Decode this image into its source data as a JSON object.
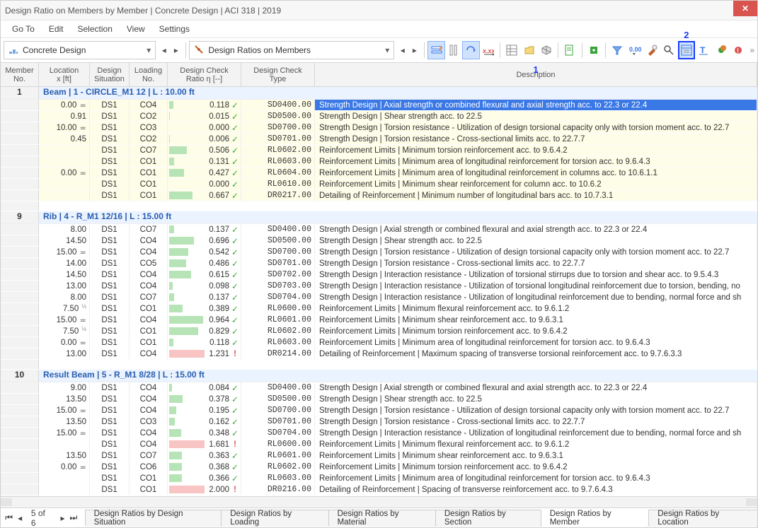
{
  "title": "Design Ratio on Members by Member | Concrete Design | ACI 318 | 2019",
  "menu": {
    "goto": "Go To",
    "edit": "Edit",
    "selection": "Selection",
    "view": "View",
    "settings": "Settings"
  },
  "toolbar": {
    "addon": "Concrete Design",
    "category": "Design Ratios on Members",
    "anno1": "1",
    "anno2": "2"
  },
  "headers": {
    "member": "Member\nNo.",
    "location": "Location\nx [ft]",
    "situation": "Design\nSituation",
    "loading": "Loading\nNo.",
    "ratio": "Design Check\nRatio η [--]",
    "type": "Design Check\nType",
    "desc": "Description"
  },
  "groups": [
    {
      "member": "1",
      "title": "Beam | 1 - CIRCLE_M1 12 | L : 10.00 ft",
      "shaded": true,
      "rows": [
        {
          "loc": "0.00",
          "mark": true,
          "sit": "DS1",
          "load": "CO4",
          "ratio": 0.118,
          "type": "SD0400.00",
          "desc": "Strength Design | Axial strength or combined flexural and axial strength acc. to 22.3 or 22.4",
          "selected": true
        },
        {
          "loc": "0.91",
          "sit": "DS1",
          "load": "CO2",
          "ratio": 0.015,
          "type": "SD0500.00",
          "desc": "Strength Design | Shear strength acc. to 22.5"
        },
        {
          "loc": "10.00",
          "mark": true,
          "sit": "DS1",
          "load": "CO3",
          "ratio": 0.0,
          "type": "SD0700.00",
          "desc": "Strength Design | Torsion resistance - Utilization of design torsional capacity only with torsion moment acc. to 22.7"
        },
        {
          "loc": "0.45",
          "sit": "DS1",
          "load": "CO2",
          "ratio": 0.006,
          "type": "SD0701.00",
          "desc": "Strength Design | Torsion resistance - Cross-sectional limits acc. to 22.7.7"
        },
        {
          "loc": "",
          "sit": "DS1",
          "load": "CO7",
          "ratio": 0.506,
          "type": "RL0602.00",
          "desc": "Reinforcement Limits | Minimum torsion reinforcement acc. to 9.6.4.2"
        },
        {
          "loc": "",
          "sit": "DS1",
          "load": "CO1",
          "ratio": 0.131,
          "type": "RL0603.00",
          "desc": "Reinforcement Limits | Minimum area of longitudinal reinforcement for torsion acc. to 9.6.4.3"
        },
        {
          "loc": "0.00",
          "mark": true,
          "sit": "DS1",
          "load": "CO1",
          "ratio": 0.427,
          "type": "RL0604.00",
          "desc": "Reinforcement Limits | Minimum area of longitudinal reinforcement in columns acc. to 10.6.1.1"
        },
        {
          "loc": "",
          "sit": "DS1",
          "load": "CO1",
          "ratio": 0.0,
          "type": "RL0610.00",
          "desc": "Reinforcement Limits | Minimum shear reinforcement for column acc. to 10.6.2"
        },
        {
          "loc": "",
          "sit": "DS1",
          "load": "CO1",
          "ratio": 0.667,
          "type": "DR0217.00",
          "desc": "Detailing of Reinforcement | Minimum number of longitudinal bars acc. to 10.7.3.1"
        }
      ]
    },
    {
      "member": "9",
      "title": "Rib | 4 - R_M1 12/16 | L : 15.00 ft",
      "shaded": false,
      "rows": [
        {
          "loc": "8.00",
          "sit": "DS1",
          "load": "CO7",
          "ratio": 0.137,
          "type": "SD0400.00",
          "desc": "Strength Design | Axial strength or combined flexural and axial strength acc. to 22.3 or 22.4"
        },
        {
          "loc": "14.50",
          "sit": "DS1",
          "load": "CO4",
          "ratio": 0.696,
          "type": "SD0500.00",
          "desc": "Strength Design | Shear strength acc. to 22.5"
        },
        {
          "loc": "15.00",
          "mark": true,
          "sit": "DS1",
          "load": "CO4",
          "ratio": 0.542,
          "type": "SD0700.00",
          "desc": "Strength Design | Torsion resistance - Utilization of design torsional capacity only with torsion moment acc. to 22.7"
        },
        {
          "loc": "14.00",
          "sit": "DS1",
          "load": "CO5",
          "ratio": 0.486,
          "type": "SD0701.00",
          "desc": "Strength Design | Torsion resistance - Cross-sectional limits acc. to 22.7.7"
        },
        {
          "loc": "14.50",
          "sit": "DS1",
          "load": "CO4",
          "ratio": 0.615,
          "type": "SD0702.00",
          "desc": "Strength Design | Interaction resistance - Utilization of torsional stirrups due to torsion and shear acc. to 9.5.4.3"
        },
        {
          "loc": "13.00",
          "sit": "DS1",
          "load": "CO4",
          "ratio": 0.098,
          "type": "SD0703.00",
          "desc": "Strength Design | Interaction resistance - Utilization of torsional longitudinal reinforcement due to torsion, bending, no"
        },
        {
          "loc": "8.00",
          "sit": "DS1",
          "load": "CO7",
          "ratio": 0.137,
          "type": "SD0704.00",
          "desc": "Strength Design | Interaction resistance - Utilization of longitudinal reinforcement due to bending, normal force and sh"
        },
        {
          "loc": "7.50",
          "half": true,
          "sit": "DS1",
          "load": "CO1",
          "ratio": 0.389,
          "type": "RL0600.00",
          "desc": "Reinforcement Limits | Minimum flexural reinforcement acc. to 9.6.1.2"
        },
        {
          "loc": "15.00",
          "mark": true,
          "sit": "DS1",
          "load": "CO4",
          "ratio": 0.964,
          "type": "RL0601.00",
          "desc": "Reinforcement Limits | Minimum shear reinforcement acc. to 9.6.3.1"
        },
        {
          "loc": "7.50",
          "half": true,
          "sit": "DS1",
          "load": "CO1",
          "ratio": 0.829,
          "type": "RL0602.00",
          "desc": "Reinforcement Limits | Minimum torsion reinforcement acc. to 9.6.4.2"
        },
        {
          "loc": "0.00",
          "mark": true,
          "sit": "DS1",
          "load": "CO1",
          "ratio": 0.118,
          "type": "RL0603.00",
          "desc": "Reinforcement Limits | Minimum area of longitudinal reinforcement for torsion acc. to 9.6.4.3"
        },
        {
          "loc": "13.00",
          "sit": "DS1",
          "load": "CO4",
          "ratio": 1.231,
          "fail": true,
          "type": "DR0214.00",
          "desc": "Detailing of Reinforcement | Maximum spacing of transverse torsional reinforcement acc. to 9.7.6.3.3"
        }
      ]
    },
    {
      "member": "10",
      "title": "Result Beam | 5 - R_M1 8/28 | L : 15.00 ft",
      "shaded": false,
      "rows": [
        {
          "loc": "9.00",
          "sit": "DS1",
          "load": "CO4",
          "ratio": 0.084,
          "type": "SD0400.00",
          "desc": "Strength Design | Axial strength or combined flexural and axial strength acc. to 22.3 or 22.4"
        },
        {
          "loc": "13.50",
          "sit": "DS1",
          "load": "CO4",
          "ratio": 0.378,
          "type": "SD0500.00",
          "desc": "Strength Design | Shear strength acc. to 22.5"
        },
        {
          "loc": "15.00",
          "mark": true,
          "sit": "DS1",
          "load": "CO4",
          "ratio": 0.195,
          "type": "SD0700.00",
          "desc": "Strength Design | Torsion resistance - Utilization of design torsional capacity only with torsion moment acc. to 22.7"
        },
        {
          "loc": "13.50",
          "sit": "DS1",
          "load": "CO3",
          "ratio": 0.162,
          "type": "SD0701.00",
          "desc": "Strength Design | Torsion resistance - Cross-sectional limits acc. to 22.7.7"
        },
        {
          "loc": "15.00",
          "mark": true,
          "sit": "DS1",
          "load": "CO4",
          "ratio": 0.348,
          "type": "SD0704.00",
          "desc": "Strength Design | Interaction resistance - Utilization of longitudinal reinforcement due to bending, normal force and sh"
        },
        {
          "loc": "",
          "sit": "DS1",
          "load": "CO4",
          "ratio": 1.681,
          "fail": true,
          "type": "RL0600.00",
          "desc": "Reinforcement Limits | Minimum flexural reinforcement acc. to 9.6.1.2"
        },
        {
          "loc": "13.50",
          "sit": "DS1",
          "load": "CO7",
          "ratio": 0.363,
          "type": "RL0601.00",
          "desc": "Reinforcement Limits | Minimum shear reinforcement acc. to 9.6.3.1"
        },
        {
          "loc": "0.00",
          "mark": true,
          "sit": "DS1",
          "load": "CO6",
          "ratio": 0.368,
          "type": "RL0602.00",
          "desc": "Reinforcement Limits | Minimum torsion reinforcement acc. to 9.6.4.2"
        },
        {
          "loc": "",
          "sit": "DS1",
          "load": "CO1",
          "ratio": 0.366,
          "type": "RL0603.00",
          "desc": "Reinforcement Limits | Minimum area of longitudinal reinforcement for torsion acc. to 9.6.4.3"
        },
        {
          "loc": "",
          "sit": "DS1",
          "load": "CO1",
          "ratio": 2.0,
          "fail": true,
          "type": "DR0216.00",
          "desc": "Detailing of Reinforcement | Spacing of transverse reinforcement acc. to 9.7.6.4.3"
        }
      ]
    }
  ],
  "pager": {
    "label": "5 of 6"
  },
  "tabs": [
    {
      "label": "Design Ratios by Design Situation"
    },
    {
      "label": "Design Ratios by Loading"
    },
    {
      "label": "Design Ratios by Material"
    },
    {
      "label": "Design Ratios by Section"
    },
    {
      "label": "Design Ratios by Member",
      "active": true
    },
    {
      "label": "Design Ratios by Location"
    }
  ]
}
